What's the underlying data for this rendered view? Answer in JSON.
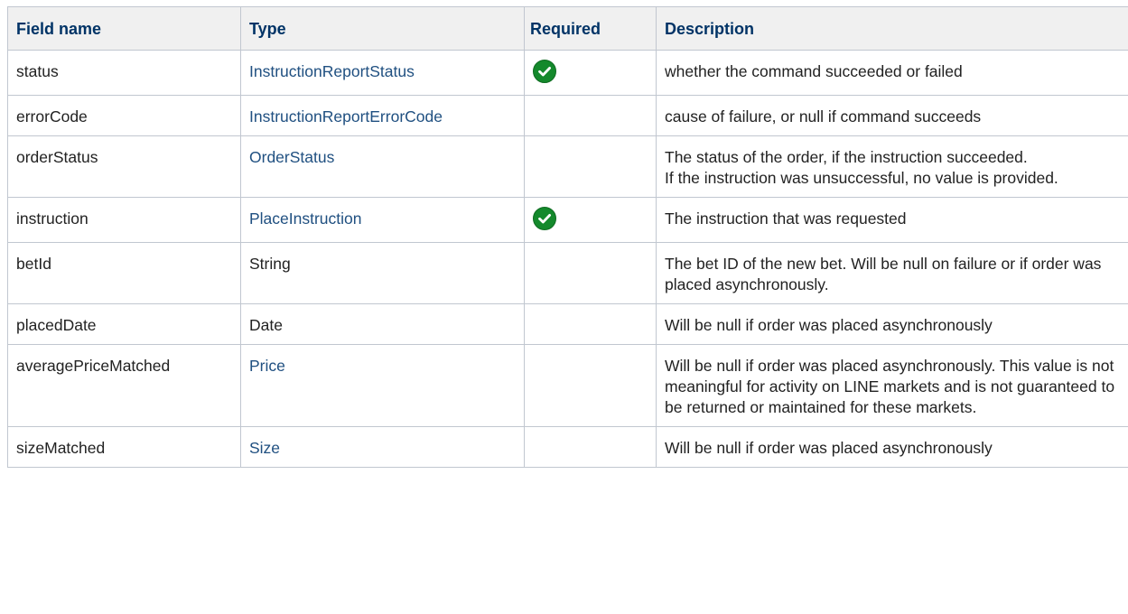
{
  "headers": {
    "field_name": "Field name",
    "type": "Type",
    "required": "Required",
    "description": "Description"
  },
  "rows": [
    {
      "field": "status",
      "type": "InstructionReportStatus",
      "type_is_link": true,
      "required": true,
      "description": [
        "whether the command succeeded or failed"
      ]
    },
    {
      "field": "errorCode",
      "type": "InstructionReportErrorCode",
      "type_is_link": true,
      "required": false,
      "description": [
        "cause of failure, or null if command succeeds"
      ]
    },
    {
      "field": "orderStatus",
      "type": "OrderStatus",
      "type_is_link": true,
      "required": false,
      "description": [
        "The status of the order, if the instruction succeeded.",
        "If the instruction was unsuccessful, no value is provided."
      ]
    },
    {
      "field": "instruction",
      "type": "PlaceInstruction",
      "type_is_link": true,
      "required": true,
      "description": [
        "The instruction that was requested"
      ]
    },
    {
      "field": "betId",
      "type": "String",
      "type_is_link": false,
      "required": false,
      "description": [
        "The bet ID of the new bet. Will be null on failure or if order was placed asynchronously."
      ]
    },
    {
      "field": "placedDate",
      "type": "Date",
      "type_is_link": false,
      "required": false,
      "description": [
        "Will be null if order was placed asynchronously"
      ]
    },
    {
      "field": "averagePriceMatched",
      "type": "Price",
      "type_is_link": true,
      "required": false,
      "description": [
        "Will be null if order was placed asynchronously. This value is not meaningful for activity on LINE markets and is not guaranteed to be returned or maintained for these markets."
      ]
    },
    {
      "field": "sizeMatched",
      "type": "Size",
      "type_is_link": true,
      "required": false,
      "description": [
        "Will be null if order was placed asynchronously"
      ]
    }
  ],
  "colors": {
    "header_text": "#003366",
    "header_bg": "#f0f0f0",
    "link": "#205081",
    "border": "#c1c7d0",
    "check_green": "#14892c"
  },
  "icons": {
    "required": "check-circle-icon"
  }
}
